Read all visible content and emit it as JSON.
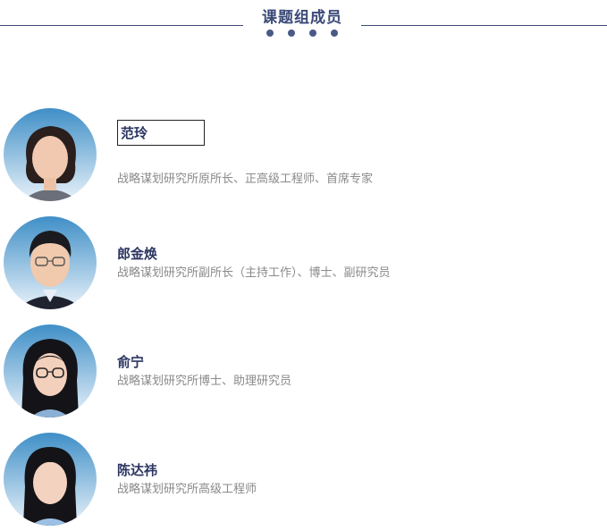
{
  "header": {
    "title": "课题组成员",
    "dots": 4
  },
  "members": [
    {
      "name": "范玲",
      "description": "战略谋划研究所原所长、正高级工程师、首席专家",
      "hair": "#2a1f1c",
      "shirt": "#6b6f7a"
    },
    {
      "name": "郎金焕",
      "description": "战略谋划研究所副所长（主持工作）、博士、副研究员",
      "hair": "#1b1b1f",
      "shirt": "#1f2330"
    },
    {
      "name": "俞宁",
      "description": "战略谋划研究所博士、助理研究员",
      "hair": "#141418",
      "shirt": "#8ab0d6"
    },
    {
      "name": "陈达祎",
      "description": "战略谋划研究所高级工程师",
      "hair": "#141418",
      "shirt": "#9cc0e4"
    }
  ],
  "colors": {
    "accent": "#3b4a78",
    "name": "#2b3560",
    "description": "#8a8a8a",
    "avatar_bg_top": "#3f8fc7",
    "avatar_bg_bottom": "#e9f2fa"
  }
}
